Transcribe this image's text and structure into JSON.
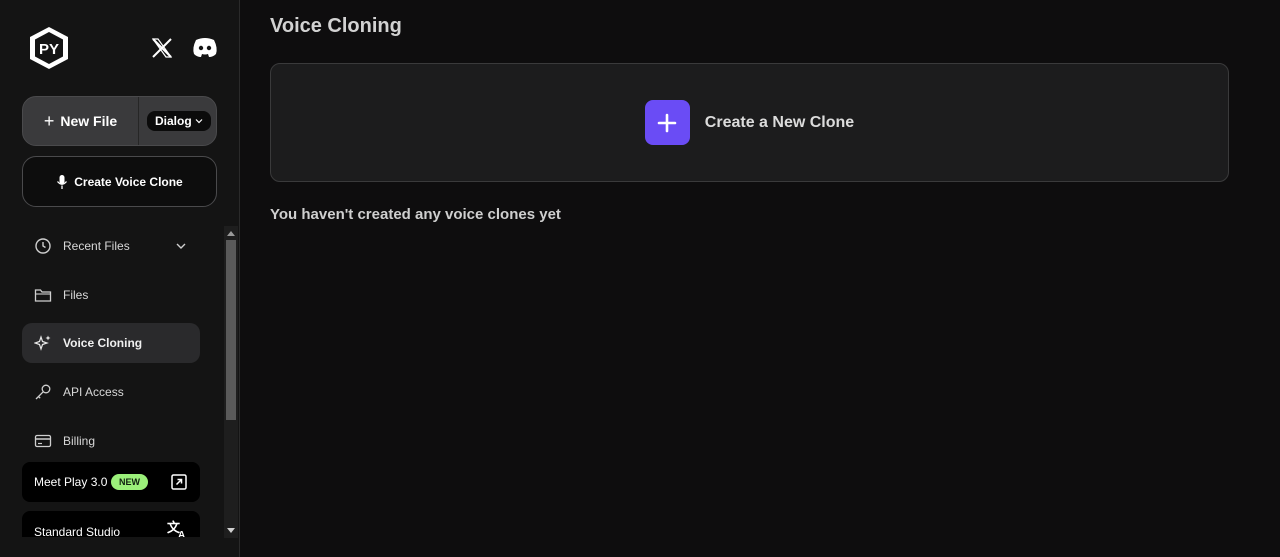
{
  "sidebar": {
    "logo_text": "PY",
    "new_file": {
      "label": "New File",
      "mode": "Dialog"
    },
    "create_clone_label": "Create Voice Clone",
    "nav": [
      {
        "label": "Recent Files",
        "icon": "clock-icon",
        "expandable": true
      },
      {
        "label": "Files",
        "icon": "folder-icon"
      },
      {
        "label": "Voice Cloning",
        "icon": "sparkles-icon",
        "active": true
      },
      {
        "label": "API Access",
        "icon": "key-icon"
      },
      {
        "label": "Billing",
        "icon": "credit-card-icon"
      }
    ],
    "promo_meet": {
      "label": "Meet Play 3.0",
      "badge": "NEW"
    },
    "promo_studio": {
      "label": "Standard Studio"
    }
  },
  "main": {
    "title": "Voice Cloning",
    "create_card_label": "Create a New Clone",
    "empty_message": "You haven't created any voice clones yet"
  },
  "colors": {
    "accent": "#6a4cf5",
    "badge": "#9bf07a",
    "background": "#0e0d0e",
    "sidebar": "#141414"
  }
}
